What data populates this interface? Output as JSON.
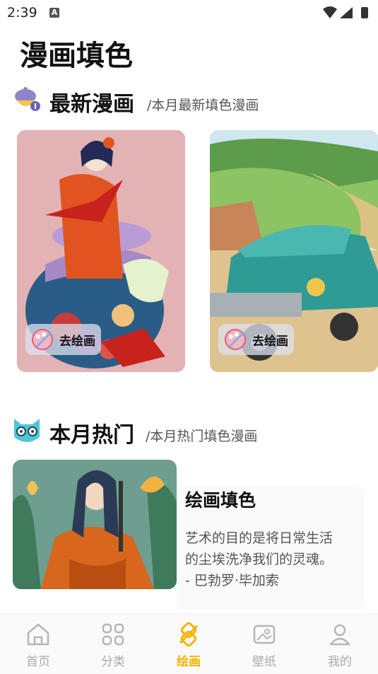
{
  "status": {
    "time": "2:39",
    "notif_letter": "A"
  },
  "page": {
    "title": "漫画填色"
  },
  "section_new": {
    "title": "最新漫画",
    "subtitle": "/本月最新填色漫画"
  },
  "cards": [
    {
      "button_label": "去绘画"
    },
    {
      "button_label": "去绘画"
    }
  ],
  "section_hot": {
    "title": "本月热门",
    "subtitle": "/本月热门填色漫画"
  },
  "feature": {
    "title": "绘画填色",
    "quote": "艺术的目的是将日常生活的尘埃洗净我们的灵魂。 - 巴勃罗·毕加索"
  },
  "tabs": [
    {
      "label": "首页",
      "icon": "home-icon",
      "active": false
    },
    {
      "label": "分类",
      "icon": "grid-icon",
      "active": false
    },
    {
      "label": "绘画",
      "icon": "paint-icon",
      "active": true
    },
    {
      "label": "壁纸",
      "icon": "wallpaper-icon",
      "active": false
    },
    {
      "label": "我的",
      "icon": "user-icon",
      "active": false
    }
  ],
  "colors": {
    "accent": "#f4b400",
    "inactive": "#aaaaaa"
  }
}
